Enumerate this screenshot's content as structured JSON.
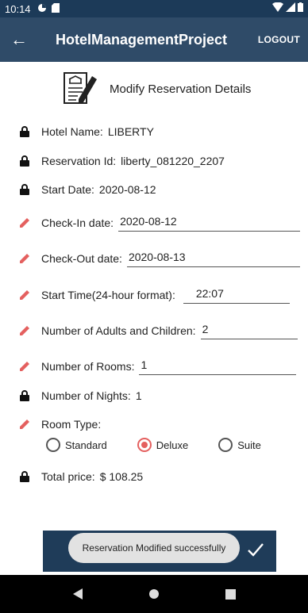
{
  "status_bar": {
    "time": "10:14"
  },
  "app_bar": {
    "back": "←",
    "title": "HotelManagementProject",
    "logout": "LOGOUT"
  },
  "header": {
    "title": "Modify Reservation Details"
  },
  "fields": {
    "hotel_name_label": "Hotel Name:",
    "hotel_name_value": "LIBERTY",
    "reservation_id_label": "Reservation Id:",
    "reservation_id_value": "liberty_081220_2207",
    "start_date_label": "Start Date:",
    "start_date_value": "2020-08-12",
    "checkin_label": "Check-In date:",
    "checkin_value": "2020-08-12",
    "checkout_label": "Check-Out date:",
    "checkout_value": "2020-08-13",
    "start_time_label": "Start Time(24-hour format):",
    "start_time_value": "22:07",
    "adults_label": "Number of Adults and Children:",
    "adults_value": "2",
    "rooms_label": "Number of Rooms:",
    "rooms_value": "1",
    "nights_label": "Number of Nights:",
    "nights_value": "1",
    "room_type_label": "Room Type:",
    "total_price_label": "Total price:",
    "total_price_value": "$ 108.25"
  },
  "room_types": {
    "standard": "Standard",
    "deluxe": "Deluxe",
    "suite": "Suite",
    "selected": "Deluxe"
  },
  "toast": "Reservation Modified successfully",
  "colors": {
    "app_bar": "#2f4b68",
    "status_bar": "#1c3a58",
    "edit_accent": "#e4605f",
    "submit_button": "#1f3c59"
  },
  "icons": [
    "back-arrow-icon",
    "document-edit-icon",
    "lock-icon",
    "pencil-icon",
    "check-icon"
  ]
}
